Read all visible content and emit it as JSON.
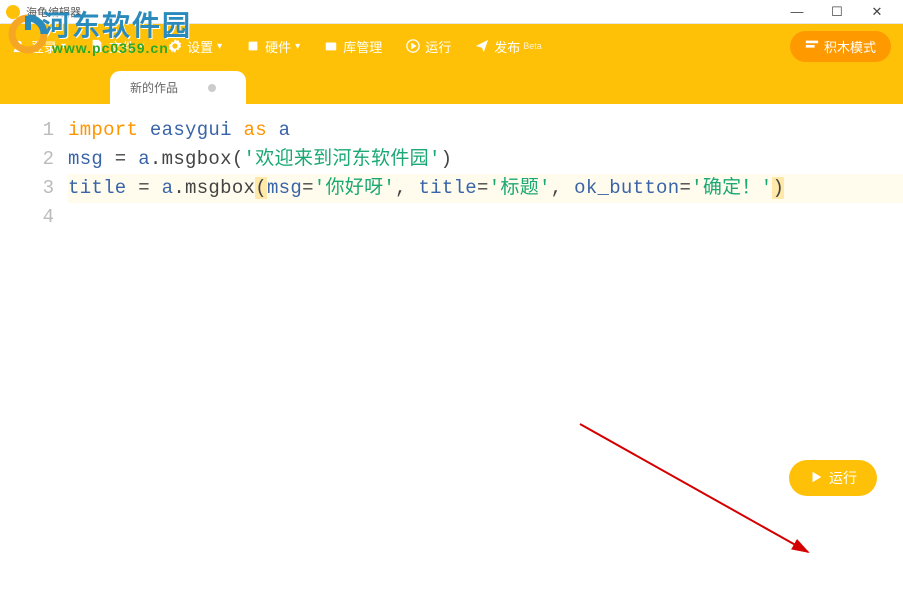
{
  "window": {
    "title": "海龟编辑器"
  },
  "toolbar": {
    "login": "登录",
    "file": "文件",
    "settings": "设置",
    "hardware": "硬件",
    "library": "库管理",
    "run": "运行",
    "publish": "发布",
    "block_mode": "积木模式"
  },
  "tabs": {
    "active": "新的作品"
  },
  "gutter": [
    "1",
    "2",
    "3",
    "4"
  ],
  "code": {
    "l1": {
      "import": "import",
      "mod": "easygui",
      "as": "as",
      "alias": "a"
    },
    "l2": {
      "var": "msg",
      "eq": " = ",
      "obj": "a",
      "dot": ".",
      "fn": "msgbox",
      "lp": "(",
      "s": "'欢迎来到河东软件园'",
      "rp": ")"
    },
    "l3": {
      "var": "title",
      "eq": " = ",
      "obj": "a",
      "dot": ".",
      "fn": "msgbox",
      "lp": "(",
      "k1": "msg",
      "eq1": "=",
      "s1": "'你好呀'",
      "c1": ", ",
      "k2": "title",
      "eq2": "=",
      "s2": "'标题'",
      "c2": ", ",
      "k3": "ok_button",
      "eq3": "=",
      "s3": "'确定！'",
      "rp": ")"
    }
  },
  "run_button": "运行",
  "watermark": {
    "line1": "河东软件园",
    "line2": "www.pc0359.cn"
  }
}
